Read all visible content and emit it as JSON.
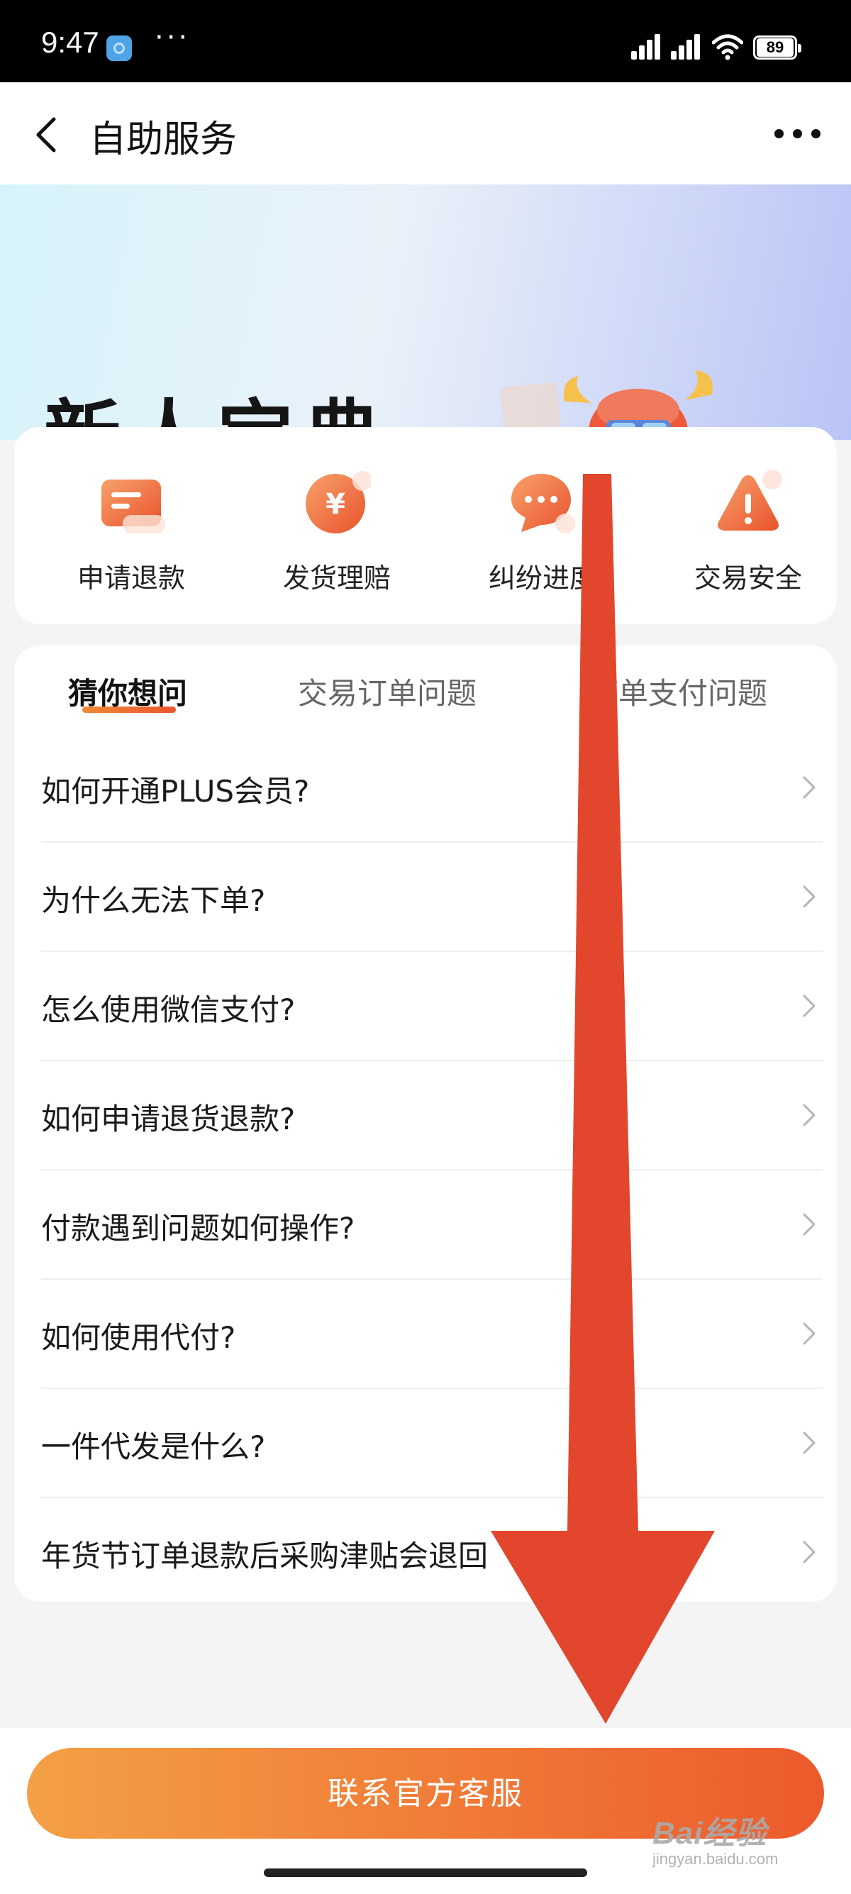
{
  "status_bar": {
    "time": "9:47",
    "dots": "···",
    "battery": "89"
  },
  "nav": {
    "title": "自助服务"
  },
  "banner": {
    "title": "新人宝典"
  },
  "services": [
    {
      "label": "申请退款",
      "icon": "card-icon"
    },
    {
      "label": "发货理赔",
      "icon": "yen-coin-icon"
    },
    {
      "label": "纠纷进度",
      "icon": "chat-bubble-icon"
    },
    {
      "label": "交易安全",
      "icon": "warning-icon"
    }
  ],
  "tabs": [
    {
      "label": "猜你想问",
      "active": true
    },
    {
      "label": "交易订单问题",
      "active": false
    },
    {
      "label": "下单支付问题",
      "active": false
    }
  ],
  "faq": [
    "如何开通PLUS会员?",
    "为什么无法下单?",
    "怎么使用微信支付?",
    "如何申请退货退款?",
    "付款遇到问题如何操作?",
    "如何使用代付?",
    "一件代发是什么?",
    "年货节订单退款后采购津贴会退回"
  ],
  "contact_button": "联系官方客服",
  "watermark": {
    "brand": "Bai经验",
    "url": "jingyan.baidu.com"
  },
  "colors": {
    "accent": "#ef6a34",
    "arrow": "#e2472d"
  }
}
